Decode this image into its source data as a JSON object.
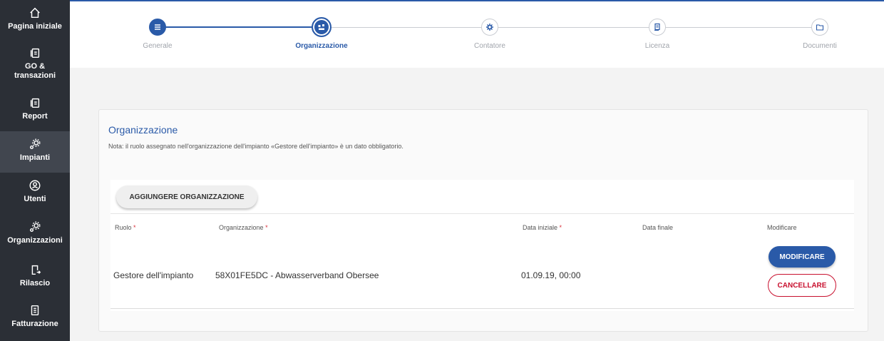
{
  "sidebar": {
    "items": [
      {
        "label": "Pagina iniziale",
        "icon": "home-icon"
      },
      {
        "label": "GO & transazioni",
        "icon": "documents-icon"
      },
      {
        "label": "Report",
        "icon": "report-icon"
      },
      {
        "label": "Impianti",
        "icon": "gears-icon"
      },
      {
        "label": "Utenti",
        "icon": "user-circle-icon"
      },
      {
        "label": "Organizzazioni",
        "icon": "gears-icon"
      },
      {
        "label": "Rilascio",
        "icon": "document-export-icon"
      },
      {
        "label": "Fatturazione",
        "icon": "invoice-icon"
      }
    ]
  },
  "stepper": {
    "steps": [
      {
        "label": "Generale",
        "state": "done",
        "icon": "list-icon"
      },
      {
        "label": "Organizzazione",
        "state": "current",
        "icon": "organization-icon"
      },
      {
        "label": "Contatore",
        "state": "todo",
        "icon": "gear-icon"
      },
      {
        "label": "Licenza",
        "state": "todo",
        "icon": "certificate-icon"
      },
      {
        "label": "Documenti",
        "state": "todo",
        "icon": "folder-icon"
      }
    ]
  },
  "card": {
    "title": "Organizzazione",
    "note": "Nota: il ruolo assegnato nell'organizzazione dell'impianto «Gestore dell'impianto» è un dato obbligatorio.",
    "add_button": "AGGIUNGERE ORGANIZZAZIONE"
  },
  "table": {
    "columns": {
      "role": "Ruolo",
      "organization": "Organizzazione",
      "start_date": "Data iniziale",
      "end_date": "Data finale",
      "edit": "Modificare"
    },
    "required_mark": "*",
    "rows": [
      {
        "role": "Gestore dell'impianto",
        "organization": "58X01FE5DC - Abwasserverband Obersee",
        "start_date": "01.09.19, 00:00",
        "end_date": "",
        "edit_label": "MODIFICARE",
        "delete_label": "CANCELLARE"
      }
    ]
  },
  "colors": {
    "primary": "#2a5aa8",
    "sidebar_bg": "#2b2f36",
    "danger": "#c8102e"
  }
}
